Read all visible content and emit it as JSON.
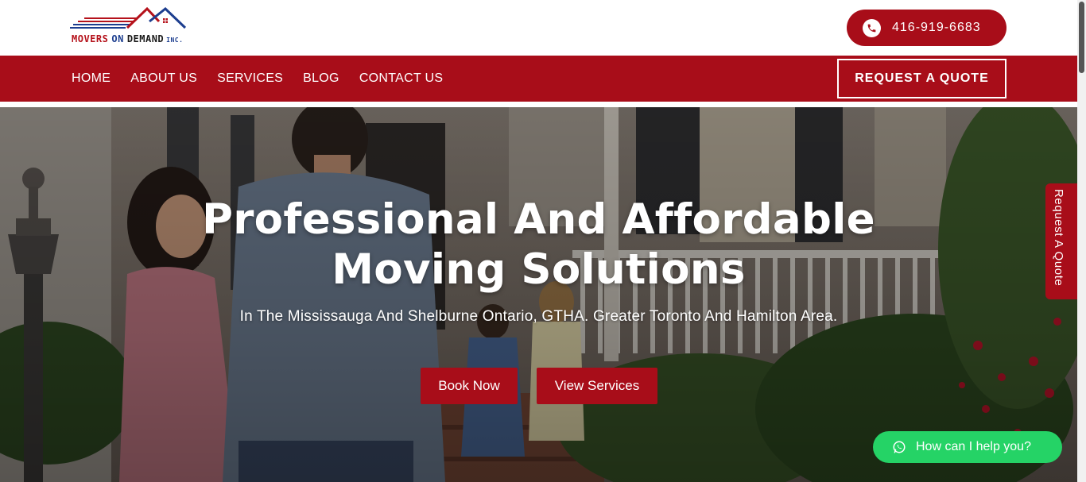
{
  "brand": {
    "logo_words": [
      "MOVERS",
      "ON",
      "DEMAND",
      "INC."
    ],
    "colors": {
      "primary_red": "#a80d19",
      "logo_blue": "#1d3e8f",
      "whatsapp_green": "#25d366"
    }
  },
  "header": {
    "phone_icon": "phone-icon",
    "phone_number": "416-919-6683"
  },
  "nav": {
    "items": [
      {
        "label": "HOME"
      },
      {
        "label": "ABOUT US"
      },
      {
        "label": "SERVICES"
      },
      {
        "label": "BLOG"
      },
      {
        "label": "CONTACT US"
      }
    ],
    "cta_label": "REQUEST A QUOTE"
  },
  "hero": {
    "title_line1": "Professional And Affordable",
    "title_line2": "Moving Solutions",
    "subtitle": "In The Mississauga And Shelburne Ontario, GTHA. Greater Toronto And Hamilton Area.",
    "buttons": {
      "book": "Book Now",
      "services": "View Services"
    }
  },
  "side_tab": {
    "label": "Request A Quote"
  },
  "chat": {
    "icon": "whatsapp-icon",
    "label": "How can I help you?"
  }
}
